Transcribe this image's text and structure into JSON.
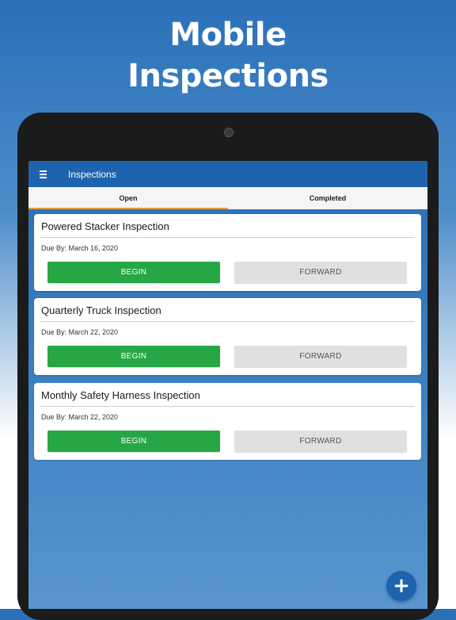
{
  "promo": {
    "title_line1": "Mobile",
    "title_line2": "Inspections"
  },
  "appbar": {
    "title": "Inspections",
    "menu_icon": "hamburger-menu-icon"
  },
  "tabs": [
    {
      "label": "Open",
      "active": true
    },
    {
      "label": "Completed",
      "active": false
    }
  ],
  "inspections": [
    {
      "title": "Powered Stacker Inspection",
      "due": "Due By: March 16, 2020",
      "begin_label": "BEGIN",
      "forward_label": "FORWARD"
    },
    {
      "title": "Quarterly Truck Inspection",
      "due": "Due By: March 22, 2020",
      "begin_label": "BEGIN",
      "forward_label": "FORWARD"
    },
    {
      "title": "Monthly Safety Harness Inspection",
      "due": "Due By: March 22, 2020",
      "begin_label": "BEGIN",
      "forward_label": "FORWARD"
    }
  ],
  "fab": {
    "icon": "plus-icon",
    "symbol": "+"
  },
  "colors": {
    "appbar": "#1e63ae",
    "begin": "#27a645",
    "forward": "#e0e0e0",
    "tab_indicator": "#e69a3a"
  }
}
